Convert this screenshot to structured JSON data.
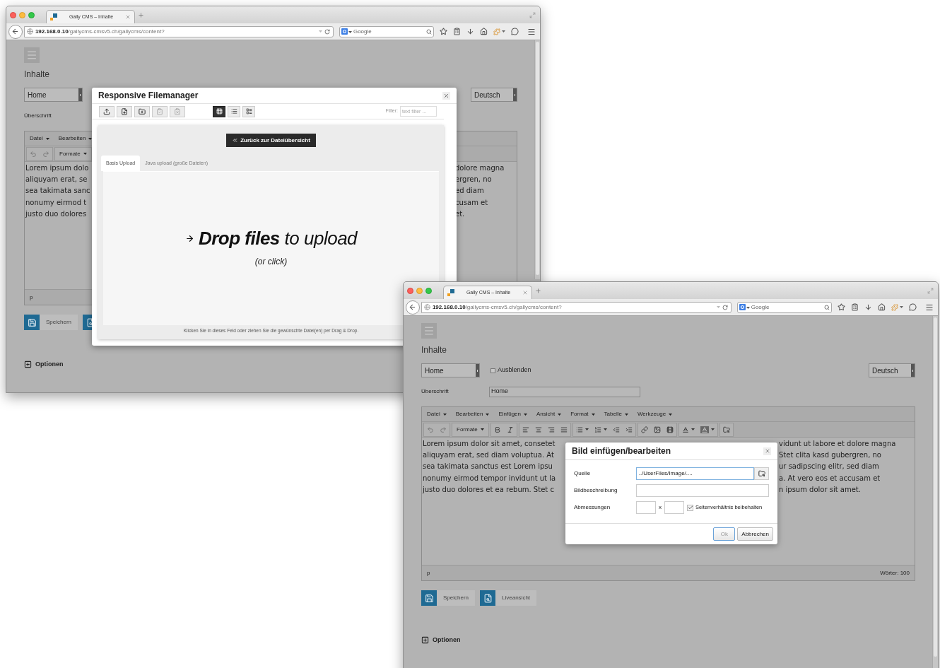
{
  "back_window": {
    "tab_title": "Gally CMS – Inhalte",
    "address": {
      "host": "192.168.0.10",
      "path": "/gallycms-cmsv5.ch/gallycms/content?"
    },
    "search": {
      "placeholder": "Google"
    },
    "page": {
      "heading": "Inhalte",
      "page_select": "Home",
      "language_select": "Deutsch",
      "title_label": "Überschrift",
      "editor": {
        "menu": [
          "Datei",
          "Bearbeiten"
        ],
        "toolbar_groups": [
          {
            "items": [
              {
                "kind": "undo"
              },
              {
                "kind": "redo"
              }
            ]
          },
          {
            "items": [
              {
                "kind": "dropdown",
                "label": "Formate"
              }
            ]
          }
        ],
        "text_left": [
          "Lorem ipsum dolo",
          "aliquyam erat, se",
          "sea takimata sanc",
          "nonumy eirmod t",
          "justo duo dolores"
        ],
        "text_right": [
          "dolore magna",
          "ergren, no",
          "ed diam",
          "cusam et",
          "et."
        ],
        "path": "p"
      },
      "buttons": [
        {
          "kind": "save",
          "label": "Speichern"
        },
        {
          "kind": "preview"
        }
      ],
      "options": "Optionen"
    },
    "filemanager": {
      "title": "Responsive Filemanager",
      "actions": [
        {
          "kind": "upload",
          "disabled": false
        },
        {
          "kind": "new-file",
          "disabled": false
        },
        {
          "kind": "new-folder",
          "disabled": false
        },
        {
          "kind": "paste",
          "disabled": true
        },
        {
          "kind": "clear",
          "disabled": true
        }
      ],
      "views": [
        {
          "kind": "grid",
          "selected": true
        },
        {
          "kind": "list",
          "selected": false
        },
        {
          "kind": "columns",
          "selected": false
        }
      ],
      "filter_label": "Filter:",
      "filter_placeholder": "text filter ...",
      "back_button": "Zurück zur Dateiübersicht",
      "tabs": [
        {
          "label": "Basis Upload",
          "selected": true
        },
        {
          "label": "Java upload (große Dateien)",
          "selected": false
        }
      ],
      "drop_text": "**Drop files** to upload",
      "drop_hint": "(or click)",
      "footer": "Klicken Sie in dieses Feld oder ziehen Sie die gewünschte Datei(en) per Drag & Drop."
    }
  },
  "front_window": {
    "tab_title": "Gally CMS – Inhalte",
    "address": {
      "host": "192.168.0.10",
      "path": "/gallycms-cmsv5.ch/gallycms/content?"
    },
    "search": {
      "placeholder": "Google"
    },
    "page": {
      "heading": "Inhalte",
      "page_select": "Home",
      "hide_checkbox": {
        "label": "Ausblenden",
        "checked": false
      },
      "language_select": "Deutsch",
      "title_label": "Überschrift",
      "title_value": "Home",
      "editor": {
        "menu": [
          "Datei",
          "Bearbeiten",
          "Einfügen",
          "Ansicht",
          "Format",
          "Tabelle",
          "Werkzeuge"
        ],
        "toolbar_groups": [
          {
            "items": [
              {
                "kind": "undo"
              },
              {
                "kind": "redo"
              }
            ]
          },
          {
            "items": [
              {
                "kind": "dropdown",
                "label": "Formate"
              }
            ]
          },
          {
            "items": [
              {
                "kind": "bold"
              },
              {
                "kind": "italic"
              }
            ]
          },
          {
            "items": [
              {
                "kind": "align-left"
              },
              {
                "kind": "align-center"
              },
              {
                "kind": "align-right"
              },
              {
                "kind": "align-justify"
              }
            ]
          },
          {
            "items": [
              {
                "kind": "bullet-list"
              },
              {
                "kind": "numbered-list"
              },
              {
                "kind": "outdent"
              },
              {
                "kind": "indent"
              }
            ]
          },
          {
            "items": [
              {
                "kind": "link"
              },
              {
                "kind": "image"
              },
              {
                "kind": "media"
              }
            ]
          },
          {
            "items": [
              {
                "kind": "text-color"
              },
              {
                "kind": "background-color"
              }
            ]
          },
          {
            "items": [
              {
                "kind": "image-manager"
              }
            ]
          }
        ],
        "text_left": [
          "Lorem ipsum dolor sit amet, consetet",
          "aliquyam erat, sed diam voluptua. At",
          "sea takimata sanctus est Lorem ipsu",
          "nonumy eirmod tempor invidunt ut la",
          "justo duo dolores et ea rebum. Stet c"
        ],
        "text_right": [
          "vidunt ut labore et dolore magna",
          "Stet clita kasd gubergren, no",
          "ur sadipscing elitr, sed diam",
          "a. At vero eos et accusam et",
          "n ipsum dolor sit amet."
        ],
        "path": "p",
        "word_count": "Wörter: 100"
      },
      "buttons": [
        {
          "kind": "save",
          "label": "Speichern"
        },
        {
          "kind": "preview",
          "label": "Liveansicht"
        }
      ],
      "options": "Optionen"
    },
    "image_dialog": {
      "title": "Bild einfügen/bearbeiten",
      "source": {
        "label": "Quelle",
        "value": "../UserFiles/Image/...."
      },
      "description": {
        "label": "Bildbeschreibung"
      },
      "dimensions": {
        "label": "Abmessungen",
        "separator": "x",
        "constrain": {
          "label": "Seitenverhältnis beibehalten",
          "checked": true
        }
      },
      "buttons": [
        {
          "label": "Ok",
          "focused": true
        },
        {
          "label": "Abbrechen",
          "focused": false
        }
      ]
    }
  }
}
